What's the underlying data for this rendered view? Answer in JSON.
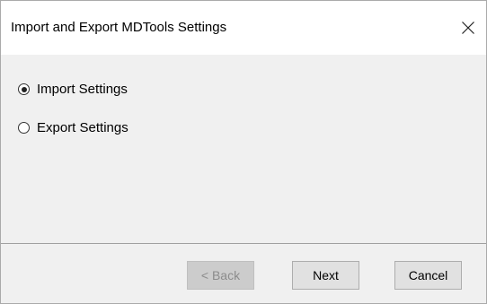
{
  "window": {
    "title": "Import and Export MDTools Settings",
    "close_icon": "close-icon"
  },
  "options": [
    {
      "label": "Import Settings",
      "selected": true
    },
    {
      "label": "Export Settings",
      "selected": false
    }
  ],
  "buttons": {
    "back_label": "< Back",
    "back_enabled": false,
    "next_label": "Next",
    "cancel_label": "Cancel"
  },
  "colors": {
    "title_bg": "#ffffff",
    "body_bg": "#f0f0f0",
    "button_bg": "#e1e1e1",
    "disabled_button_bg": "#cccccc",
    "disabled_text": "#8c8c8c"
  }
}
